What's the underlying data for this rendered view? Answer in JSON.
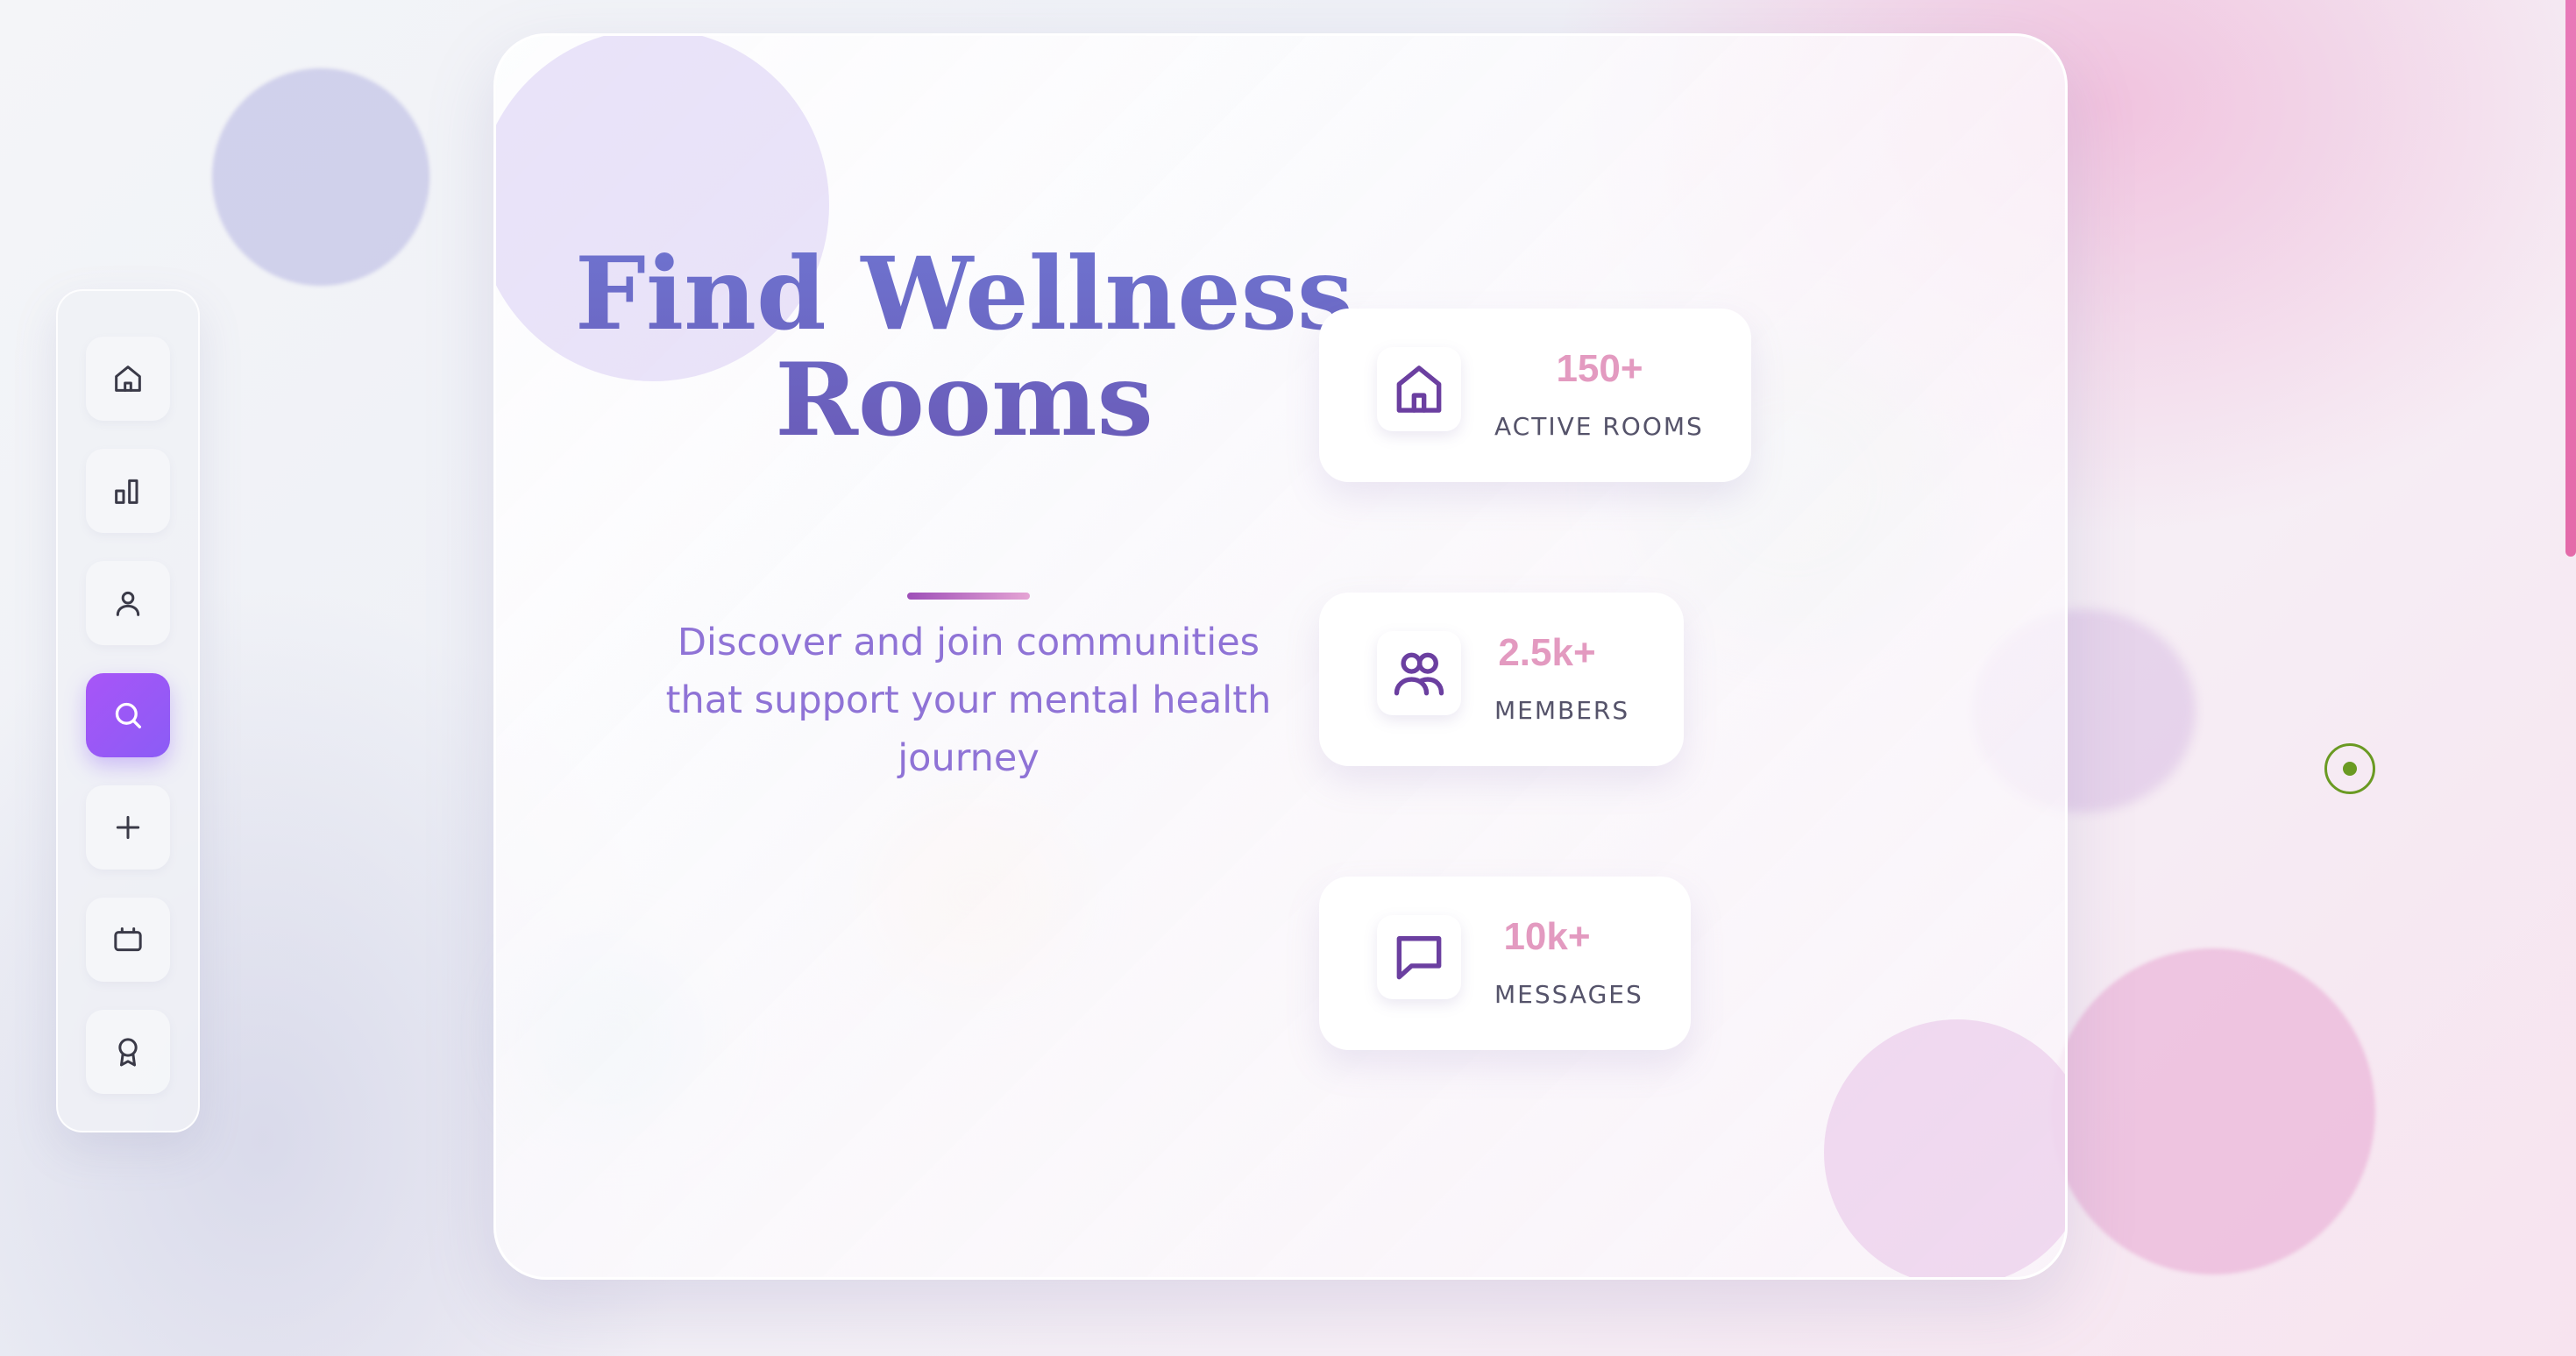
{
  "hero": {
    "title": "Find Wellness Rooms",
    "subtitle": "Discover and join communities that support your mental health journey"
  },
  "sidebar": {
    "items": [
      {
        "icon": "home-icon",
        "active": false
      },
      {
        "icon": "bar-chart-icon",
        "active": false
      },
      {
        "icon": "user-icon",
        "active": false
      },
      {
        "icon": "search-icon",
        "active": true
      },
      {
        "icon": "plus-icon",
        "active": false
      },
      {
        "icon": "tv-icon",
        "active": false
      },
      {
        "icon": "award-icon",
        "active": false
      }
    ]
  },
  "stats": [
    {
      "value": "150+",
      "label": "ACTIVE ROOMS",
      "icon": "house-icon"
    },
    {
      "value": "2.5k+",
      "label": "MEMBERS",
      "icon": "users-icon"
    },
    {
      "value": "10k+",
      "label": "MESSAGES",
      "icon": "message-square-icon"
    }
  ],
  "colors": {
    "accent": "#8b5cf6",
    "title": "#6b68c4",
    "subtitle": "#8f73d6",
    "stat_value": "#e39ac0",
    "icon": "#6b3fa0",
    "cursor": "#6a9a22"
  }
}
